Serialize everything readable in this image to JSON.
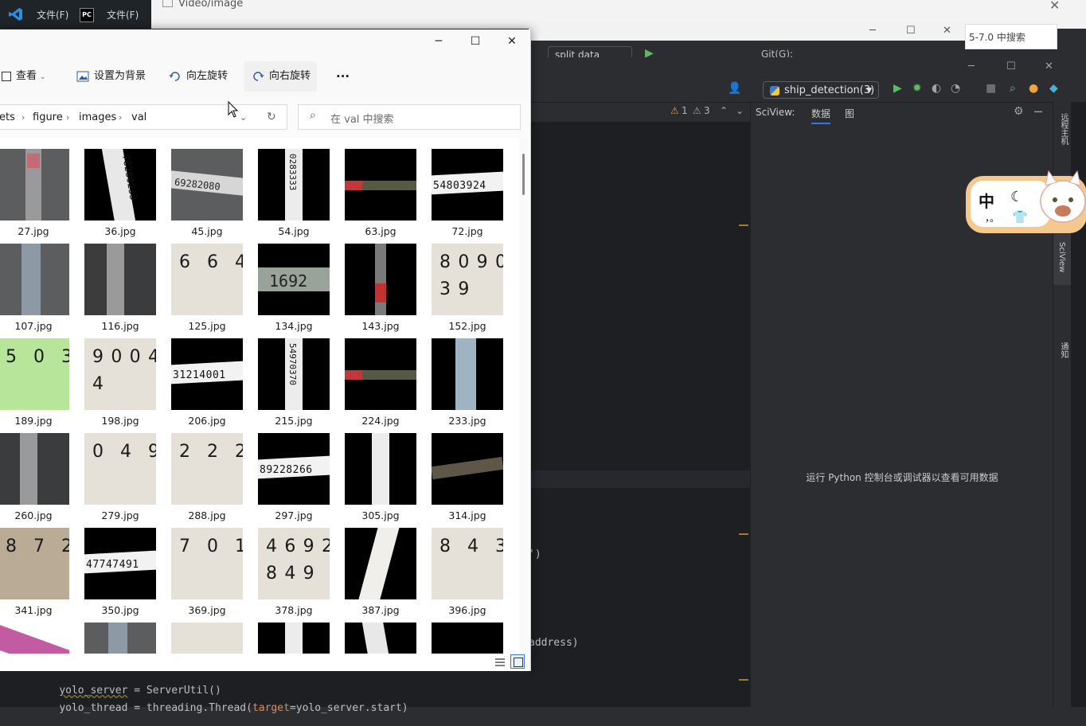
{
  "taskbar": {
    "vscode_menu": "文件(F)",
    "pycharm_menu": "文件(F)",
    "path": "Video/image"
  },
  "mid_ide": {
    "run_config": "split data",
    "git_label": "Git(G):",
    "search_text": "5-7.0 中搜索"
  },
  "ide": {
    "run_config": "ship_detection(3)",
    "warnings": "1",
    "weak_warnings": "3",
    "sciview_label": "SciView:",
    "tab_data": "数据",
    "tab_plot": "图",
    "empty_message": "运行 Python 控制台或调试器以查看可用数据",
    "rail_remote": "远程主机",
    "rail_sciview": "SciView",
    "rail_notifications": "通知",
    "code_fragments": {
      "paren": "')",
      "address": "address)",
      "line1_var": "yolo_server",
      "line1_rest": " = ServerUtil()",
      "line2_var": "yolo_thread",
      "line2_mid": " = threading.Thread(",
      "line2_kw": "target",
      "line2_end": "=yolo_server.start)"
    }
  },
  "widget": {
    "char": "中",
    "dot": "，。"
  },
  "explorer": {
    "cmdbar": {
      "view": "查看",
      "set_background": "设置为背景",
      "rotate_left": "向左旋转",
      "rotate_right": "向右旋转",
      "more": "···"
    },
    "breadcrumb": [
      "ets",
      "figure",
      "images",
      "val"
    ],
    "search_placeholder": "在 val 中搜索",
    "files": [
      {
        "name": "27.jpg",
        "style": "gray-strip-red"
      },
      {
        "name": "36.jpg",
        "style": "black-diag",
        "text": "78280233"
      },
      {
        "name": "45.jpg",
        "style": "gray-horz",
        "text": "69282080"
      },
      {
        "name": "54.jpg",
        "style": "black-vert",
        "text": "0283333"
      },
      {
        "name": "63.jpg",
        "style": "black-red-horz"
      },
      {
        "name": "72.jpg",
        "style": "black-horz-white",
        "text": "54803924"
      },
      {
        "name": "107.jpg",
        "style": "gray-strip-blue"
      },
      {
        "name": "116.jpg",
        "style": "dark-gray-strip"
      },
      {
        "name": "125.jpg",
        "style": "paper",
        "text": "6 6 4"
      },
      {
        "name": "134.jpg",
        "style": "black-horz-short",
        "text": "1692"
      },
      {
        "name": "143.jpg",
        "style": "black-vert-red"
      },
      {
        "name": "152.jpg",
        "style": "paper",
        "text": "8 0 9 0 3 9"
      },
      {
        "name": "189.jpg",
        "style": "green",
        "text": "5 0 3"
      },
      {
        "name": "198.jpg",
        "style": "paper-curve",
        "text": "9 0 0 4 4"
      },
      {
        "name": "206.jpg",
        "style": "black-horz-white",
        "text": "31214001"
      },
      {
        "name": "215.jpg",
        "style": "black-vert",
        "text": "54970370"
      },
      {
        "name": "224.jpg",
        "style": "black-red-horz"
      },
      {
        "name": "233.jpg",
        "style": "black-vert-blue"
      },
      {
        "name": "260.jpg",
        "style": "dark-gray-strip"
      },
      {
        "name": "279.jpg",
        "style": "paper",
        "text": "0 4 9"
      },
      {
        "name": "288.jpg",
        "style": "paper",
        "text": "2 2 2"
      },
      {
        "name": "297.jpg",
        "style": "black-horz-white",
        "text": "89228266"
      },
      {
        "name": "305.jpg",
        "style": "black-vert"
      },
      {
        "name": "314.jpg",
        "style": "black-horz-dim"
      },
      {
        "name": "341.jpg",
        "style": "paper-dark",
        "text": "8 7 2"
      },
      {
        "name": "350.jpg",
        "style": "black-horz-white",
        "text": "47747491"
      },
      {
        "name": "369.jpg",
        "style": "paper",
        "text": "7 0 1"
      },
      {
        "name": "378.jpg",
        "style": "paper",
        "text": "4 6 9 2 8 4 9"
      },
      {
        "name": "387.jpg",
        "style": "black-diag-white"
      },
      {
        "name": "396.jpg",
        "style": "paper",
        "text": "8 4 3"
      },
      {
        "name": "",
        "style": "pink"
      },
      {
        "name": "",
        "style": "gray-strip-blue"
      },
      {
        "name": "",
        "style": "paper"
      },
      {
        "name": "",
        "style": "black-vert"
      },
      {
        "name": "",
        "style": "black-diag"
      },
      {
        "name": "",
        "style": "black"
      }
    ]
  },
  "colors": {
    "ide_bg": "#1e1f22",
    "ide_panel": "#2b2d30",
    "accent": "#3574f0",
    "warning": "#d8a23a"
  }
}
